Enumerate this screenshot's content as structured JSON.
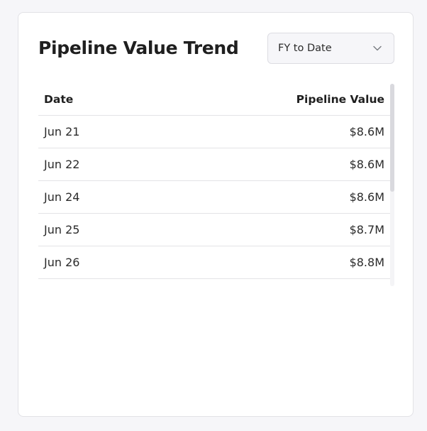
{
  "widget": {
    "title": "Pipeline Value Trend",
    "range_select": {
      "selected": "FY to Date"
    },
    "table": {
      "columns": [
        "Date",
        "Pipeline Value"
      ],
      "rows": [
        {
          "date": "Jun 21",
          "value": "$8.6M"
        },
        {
          "date": "Jun 22",
          "value": "$8.6M"
        },
        {
          "date": "Jun 24",
          "value": "$8.6M"
        },
        {
          "date": "Jun 25",
          "value": "$8.7M"
        },
        {
          "date": "Jun 26",
          "value": "$8.8M"
        }
      ]
    },
    "icons": {
      "dropdown": "chevron-down-icon"
    },
    "colors": {
      "card_background": "#ffffff",
      "page_background": "#f6f6f9",
      "divider": "#e3e3e6",
      "text_primary": "#1f1f1f"
    }
  }
}
